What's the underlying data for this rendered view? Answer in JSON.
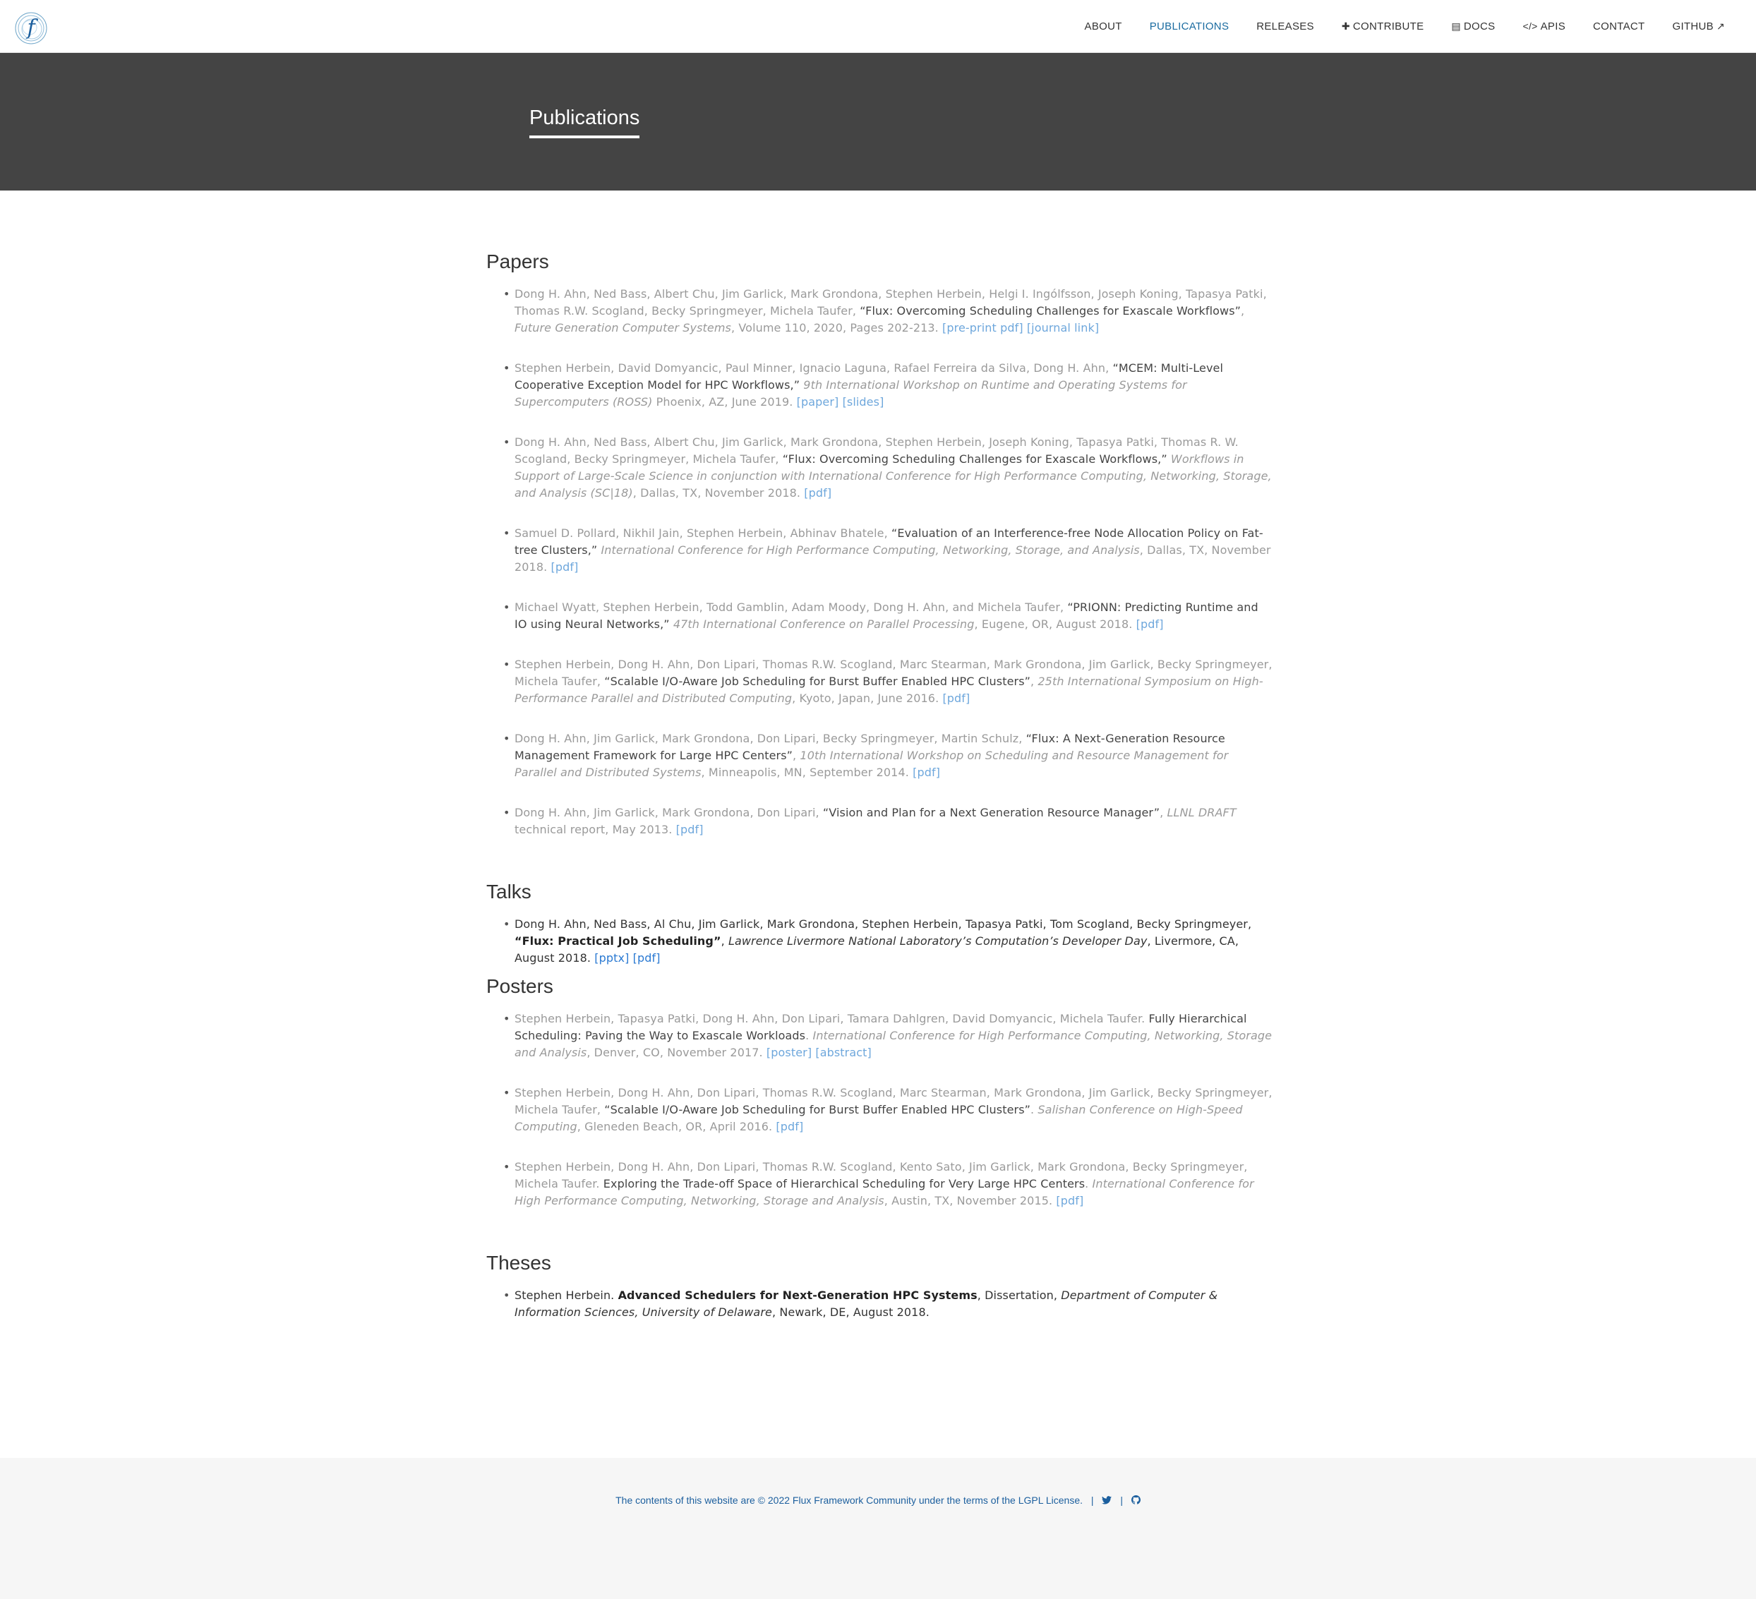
{
  "nav": {
    "items": [
      {
        "label": "ABOUT",
        "icon": ""
      },
      {
        "label": "PUBLICATIONS",
        "icon": "",
        "active": true
      },
      {
        "label": "RELEASES",
        "icon": ""
      },
      {
        "label": "CONTRIBUTE",
        "icon": "plus-icon"
      },
      {
        "label": "DOCS",
        "icon": "file-icon"
      },
      {
        "label": "APIS",
        "icon": "code-icon"
      },
      {
        "label": "CONTACT",
        "icon": ""
      },
      {
        "label": "GITHUB",
        "icon": "external-link-icon"
      }
    ]
  },
  "hero": {
    "title": "Publications"
  },
  "sections": {
    "papers": {
      "heading": "Papers",
      "items": [
        {
          "authors": "Dong H. Ahn, Ned Bass, Albert Chu, Jim Garlick, Mark Grondona, Stephen Herbein, Helgi I. Ingólfsson, Joseph Koning, Tapasya Patki, Thomas R.W. Scogland, Becky Springmeyer, Michela Taufer, ",
          "title": "“Flux: Overcoming Scheduling Challenges for Exascale Workflows”",
          "sep": ", ",
          "venue": "Future Generation Computer Systems",
          "rest": ", Volume 110, 2020, Pages 202-213. ",
          "links": [
            "[pre-print pdf]",
            "[journal link]"
          ]
        },
        {
          "authors": "Stephen Herbein, David Domyancic, Paul Minner, Ignacio Laguna, Rafael Ferreira da Silva, Dong H. Ahn, ",
          "title": "“MCEM: Multi-Level Cooperative Exception Model for HPC Workflows,”",
          "sep": " ",
          "venue": "9th International Workshop on Runtime and Operating Systems for Supercomputers (ROSS)",
          "rest": " Phoenix, AZ, June 2019. ",
          "links": [
            "[paper]",
            "[slides]"
          ]
        },
        {
          "authors": "Dong H. Ahn, Ned Bass, Albert Chu, Jim Garlick, Mark Grondona, Stephen Herbein, Joseph Koning, Tapasya Patki, Thomas R. W. Scogland, Becky Springmeyer, Michela Taufer, ",
          "title": "“Flux: Overcoming Scheduling Challenges for Exascale Workflows,”",
          "sep": " ",
          "venue": "Workflows in Support of Large-Scale Science in conjunction with International Conference for High Performance Computing, Networking, Storage, and Analysis (SC|18)",
          "rest": ", Dallas, TX, November 2018. ",
          "links": [
            "[pdf]"
          ]
        },
        {
          "authors": "Samuel D. Pollard, Nikhil Jain, Stephen Herbein, Abhinav Bhatele, ",
          "title": "“Evaluation of an Interference-free Node Allocation Policy on Fat-tree Clusters,”",
          "sep": " ",
          "venue": "International Conference for High Performance Computing, Networking, Storage, and Analysis",
          "rest": ", Dallas, TX, November 2018. ",
          "links": [
            "[pdf]"
          ]
        },
        {
          "authors": "Michael Wyatt, Stephen Herbein, Todd Gamblin, Adam Moody, Dong H. Ahn, and Michela Taufer, ",
          "title": "“PRIONN: Predicting Runtime and IO using Neural Networks,”",
          "sep": " ",
          "venue": "47th International Conference on Parallel Processing",
          "rest": ", Eugene, OR, August 2018. ",
          "links": [
            "[pdf]"
          ]
        },
        {
          "authors": "Stephen Herbein, Dong H. Ahn, Don Lipari, Thomas R.W. Scogland, Marc Stearman, Mark Grondona, Jim Garlick, Becky Springmeyer, Michela Taufer, ",
          "title": "“Scalable I/O-Aware Job Scheduling for Burst Buffer Enabled HPC Clusters”",
          "sep": ", ",
          "venue": "25th International Symposium on High-Performance Parallel and Distributed Computing",
          "rest": ", Kyoto, Japan, June 2016. ",
          "links": [
            "[pdf]"
          ]
        },
        {
          "authors": "Dong H. Ahn, Jim Garlick, Mark Grondona, Don Lipari, Becky Springmeyer, Martin Schulz, ",
          "title": "“Flux: A Next-Generation Resource Management Framework for Large HPC Centers”",
          "sep": ", ",
          "venue": "10th International Workshop on Scheduling and Resource Management for Parallel and Distributed Systems",
          "rest": ", Minneapolis, MN, September 2014. ",
          "links": [
            "[pdf]"
          ]
        },
        {
          "authors": "Dong H. Ahn, Jim Garlick, Mark Grondona, Don Lipari, ",
          "title": "“Vision and Plan for a Next Generation Resource Manager”",
          "sep": ", ",
          "venue": "LLNL DRAFT",
          "rest": " technical report, May 2013. ",
          "links": [
            "[pdf]"
          ]
        }
      ]
    },
    "talks": {
      "heading": "Talks",
      "items": [
        {
          "authors": "Dong H. Ahn, Ned Bass, Al Chu, Jim Garlick, Mark Grondona, Stephen Herbein, Tapasya Patki, Tom Scogland, Becky Springmeyer, ",
          "title": "“Flux: Practical Job Scheduling”",
          "sep": ", ",
          "venue": "Lawrence Livermore National Laboratory’s Computation’s Developer Day",
          "rest": ", Livermore, CA, August 2018. ",
          "links": [
            "[pptx]",
            "[pdf]"
          ]
        }
      ]
    },
    "posters": {
      "heading": "Posters",
      "items": [
        {
          "authors": "Stephen Herbein, Tapasya Patki, Dong H. Ahn, Don Lipari, Tamara Dahlgren, David Domyancic, Michela Taufer. ",
          "title": "Fully Hierarchical Scheduling: Paving the Way to Exascale Workloads",
          "sep": ". ",
          "venue": "International Conference for High Performance Computing, Networking, Storage and Analysis",
          "rest": ", Denver, CO, November 2017. ",
          "links": [
            "[poster]",
            "[abstract]"
          ]
        },
        {
          "authors": "Stephen Herbein, Dong H. Ahn, Don Lipari, Thomas R.W. Scogland, Marc Stearman, Mark Grondona, Jim Garlick, Becky Springmeyer, Michela Taufer, ",
          "title": "“Scalable I/O-Aware Job Scheduling for Burst Buffer Enabled HPC Clusters”",
          "sep": ". ",
          "venue": "Salishan Conference on High-Speed Computing",
          "rest": ", Gleneden Beach, OR, April 2016. ",
          "links": [
            "[pdf]"
          ]
        },
        {
          "authors": "Stephen Herbein, Dong H. Ahn, Don Lipari, Thomas R.W. Scogland, Kento Sato, Jim Garlick, Mark Grondona, Becky Springmeyer, Michela Taufer. ",
          "title": "Exploring the Trade-off Space of Hierarchical Scheduling for Very Large HPC Centers",
          "sep": ". ",
          "venue": "International Conference for High Performance Computing, Networking, Storage and Analysis",
          "rest": ", Austin, TX, November 2015. ",
          "links": [
            "[pdf]"
          ]
        }
      ]
    },
    "theses": {
      "heading": "Theses",
      "items": [
        {
          "authors": "Stephen Herbein. ",
          "title": "Advanced Schedulers for Next-Generation HPC Systems",
          "sep": ", Dissertation, ",
          "venue": "Department of Computer & Information Sciences, University of Delaware",
          "rest": ", Newark, DE, August 2018.",
          "links": []
        }
      ]
    }
  },
  "footer": {
    "text_before": "The contents of this website are © 2022 ",
    "community_link": "Flux Framework Community",
    "text_middle": " under the terms of the ",
    "license_link": "LGPL License",
    "text_after": ".",
    "separator": "|",
    "icons": [
      "twitter-icon",
      "github-icon"
    ]
  }
}
